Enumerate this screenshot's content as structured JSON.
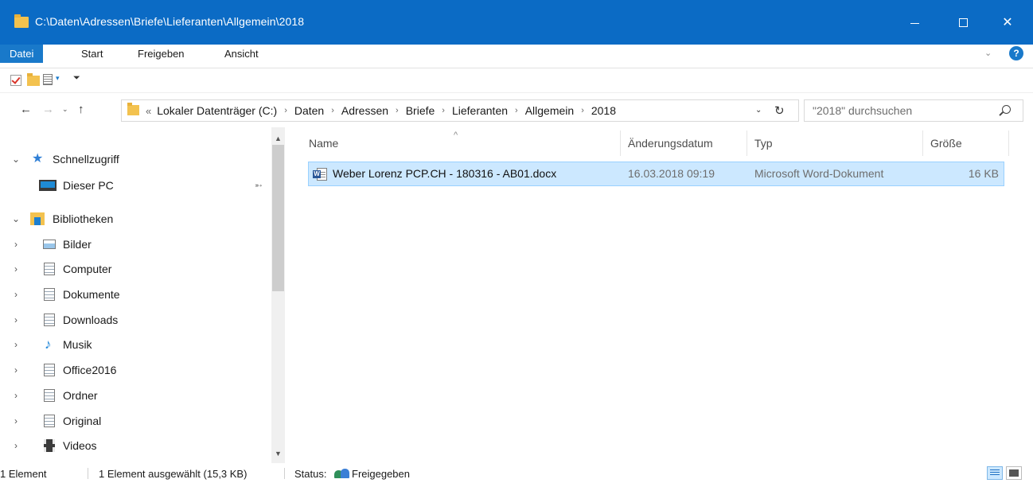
{
  "window": {
    "title": "C:\\Daten\\Adressen\\Briefe\\Lieferanten\\Allgemein\\2018",
    "minimize_glyph": "—",
    "close_glyph": "✕"
  },
  "ribbon": {
    "tabs": [
      "Datei",
      "Start",
      "Freigeben",
      "Ansicht"
    ],
    "help_glyph": "?",
    "expand_glyph": "⌄"
  },
  "quick_access": {
    "dropdown_glyph": "▾",
    "customize_glyph": "⏷"
  },
  "nav": {
    "back_glyph": "←",
    "forward_glyph": "→",
    "recent_glyph": "⌄",
    "up_glyph": "↑"
  },
  "address": {
    "lead": "«",
    "crumbs": [
      "Lokaler Datenträger (C:)",
      "Daten",
      "Adressen",
      "Briefe",
      "Lieferanten",
      "Allgemein",
      "2018"
    ],
    "separator": "›",
    "dropdown_glyph": "⌄",
    "refresh_glyph": "↻"
  },
  "search": {
    "placeholder": "\"2018\" durchsuchen"
  },
  "navigation_pane": {
    "items": [
      {
        "label": "Schnellzugriff",
        "icon": "star-icon",
        "expander": "⌄"
      },
      {
        "label": "Dieser PC",
        "icon": "pc-icon",
        "expander": ""
      },
      {
        "label": "Bibliotheken",
        "icon": "library-icon",
        "expander": "⌄"
      },
      {
        "label": "Bilder",
        "icon": "pictures-icon",
        "expander": "›"
      },
      {
        "label": "Computer",
        "icon": "document-library-icon",
        "expander": "›"
      },
      {
        "label": "Dokumente",
        "icon": "documents-icon",
        "expander": "›"
      },
      {
        "label": "Downloads",
        "icon": "document-library-icon",
        "expander": "›"
      },
      {
        "label": "Musik",
        "icon": "music-icon",
        "expander": "›"
      },
      {
        "label": "Office2016",
        "icon": "document-library-icon",
        "expander": "›"
      },
      {
        "label": "Ordner",
        "icon": "document-library-icon",
        "expander": "›"
      },
      {
        "label": "Original",
        "icon": "document-library-icon",
        "expander": "›"
      },
      {
        "label": "Videos",
        "icon": "videos-icon",
        "expander": "›"
      }
    ],
    "pin_glyph": "📌",
    "scroll_up_glyph": "▲",
    "scroll_down_glyph": "▼"
  },
  "file_list": {
    "columns": [
      "Name",
      "Änderungsdatum",
      "Typ",
      "Größe"
    ],
    "sort_glyph": "^",
    "rows": [
      {
        "name": "Weber Lorenz PCP.CH  - 180316 - AB01.docx",
        "date": "16.03.2018 09:19",
        "type": "Microsoft Word-Dokument",
        "size": "16 KB",
        "selected": true,
        "icon": "word-document-icon",
        "icon_letter": "W"
      }
    ]
  },
  "statusbar": {
    "count": "1 Element",
    "selection": "1 Element ausgewählt (15,3 KB)",
    "status_label": "Status:",
    "status_value": "Freigegeben"
  }
}
